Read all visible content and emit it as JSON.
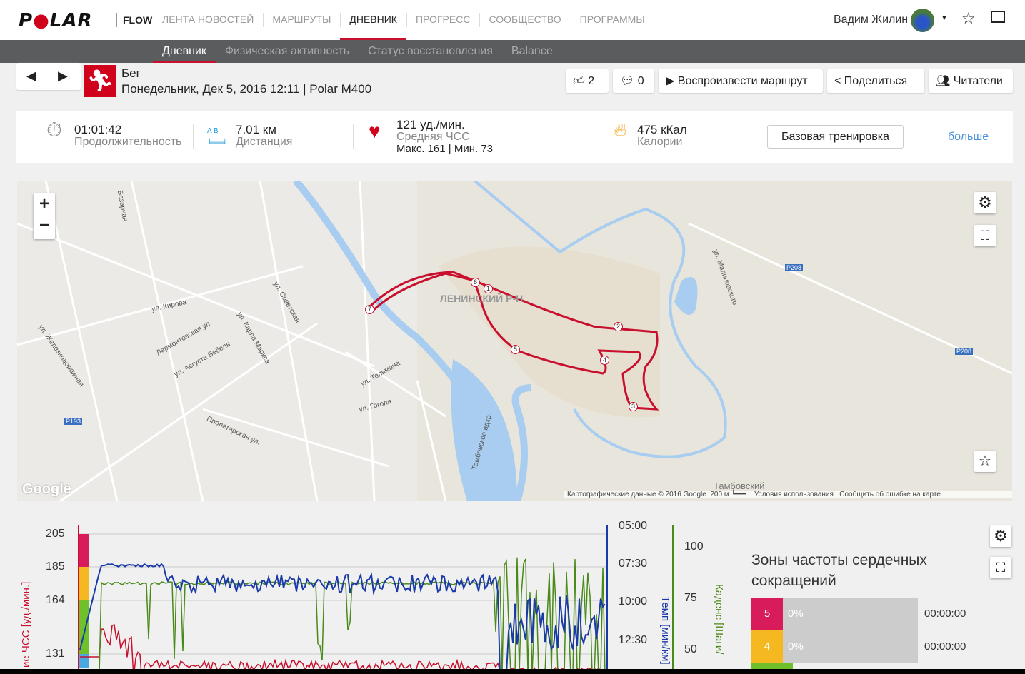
{
  "brand": {
    "logo": "POLAR",
    "product": "FLOW"
  },
  "nav": {
    "items": [
      "ЛЕНТА НОВОСТЕЙ",
      "МАРШРУТЫ",
      "ДНЕВНИК",
      "ПРОГРЕСС",
      "СООБЩЕСТВО",
      "ПРОГРАММЫ"
    ],
    "active": "ДНЕВНИК"
  },
  "user": {
    "name": "Вадим Жилин"
  },
  "subnav": {
    "items": [
      "Дневник",
      "Физическая активность",
      "Статус восстановления",
      "Balance"
    ]
  },
  "session": {
    "sport": "Бег",
    "details": "Понедельник, Дек 5, 2016 12:11 | Polar M400"
  },
  "actions": {
    "likes": "2",
    "comments": "0",
    "replay": "Воспроизвести маршрут",
    "share": "Поделиться",
    "followers": "Читатели"
  },
  "summary": {
    "duration": "01:01:42",
    "duration_label": "Продолжительность",
    "distance": "7.01 км",
    "distance_label": "Дистанция",
    "ab": "A  B",
    "hr_avg": "121 уд./мин.",
    "hr_label": "Средняя ЧСС",
    "hr_minmax": "Макс. 161  |  Мин. 73",
    "calories": "475 кКал",
    "calories_label": "Калории",
    "training": "Базовая тренировка",
    "more": "больше"
  },
  "map": {
    "district": "ЛЕНИНСКИЙ Р-Н",
    "streets": [
      "ул. Кирова",
      "Лермонтовская ул.",
      "ул. Августа Бебеля",
      "ул. Карла Маркса",
      "ул. Советская",
      "ул. Тельмана",
      "ул. Гоголя",
      "ул. Железнодорожная",
      "Пролетарская ул.",
      "Базарная",
      "Тамбовское вдхр.",
      "ул. Малиновского",
      "Тамбовский"
    ],
    "road_badges": [
      "P208",
      "P208",
      "P193"
    ],
    "markers": [
      "1",
      "2",
      "3",
      "4",
      "5",
      "6",
      "7"
    ],
    "attribution": "Картографические данные © 2016 Google",
    "scale": "200 м",
    "terms": "Условия использования",
    "report": "Сообщить об ошибке на карте",
    "google": "Google"
  },
  "chart_data": {
    "type": "line",
    "ylabel_left": "ие ЧСС [уд./мин.]",
    "ylabel_pace": "Темп [мин/км]",
    "ylabel_cadence": "Каденс [Шаги/",
    "hr_ticks": [
      "205",
      "185",
      "164",
      "131"
    ],
    "pace_ticks": [
      "05:00",
      "07:30",
      "10:00",
      "12:30"
    ],
    "cadence_ticks": [
      "100",
      "75",
      "50"
    ],
    "series": [
      {
        "name": "ЧСС",
        "color": "#c8102e"
      },
      {
        "name": "Темп",
        "color": "#1a3aa8"
      },
      {
        "name": "Каденс",
        "color": "#4a8a1a"
      }
    ]
  },
  "zones": {
    "title": "Зоны частоты сердечных сокращений",
    "items": [
      {
        "zone": "5",
        "percent": "0%",
        "time": "00:00:00",
        "color": "#d81b5a"
      },
      {
        "zone": "4",
        "percent": "0%",
        "time": "00:00:00",
        "color": "#f5b820"
      }
    ]
  }
}
